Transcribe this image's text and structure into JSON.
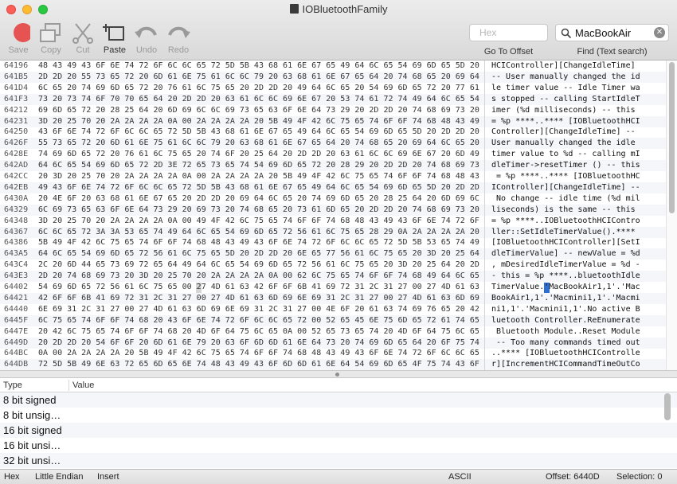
{
  "window": {
    "title": "IOBluetoothFamily"
  },
  "toolbar": {
    "save_label": "Save",
    "copy_label": "Copy",
    "cut_label": "Cut",
    "paste_label": "Paste",
    "undo_label": "Undo",
    "redo_label": "Redo",
    "goto_placeholder": "Hex",
    "goto_label": "Go To Offset",
    "search_value": "MacBookAir",
    "find_label": "Find (Text search)"
  },
  "hex_rows": [
    {
      "offset": "64196",
      "bytes": "48 43 49 43 6F 6E 74 72 6F 6C 6C 65 72 5D 5B 43 68 61 6E 67 65 49 64 6C 65 54 69 6D 65 5D 20",
      "ascii": "HCIController][ChangeIdleTime]"
    },
    {
      "offset": "641B5",
      "bytes": "2D 2D 20 55 73 65 72 20 6D 61 6E 75 61 6C 6C 79 20 63 68 61 6E 67 65 64 20 74 68 65 20 69 64",
      "ascii": "-- User manually changed the id"
    },
    {
      "offset": "641D4",
      "bytes": "6C 65 20 74 69 6D 65 72 20 76 61 6C 75 65 20 2D 2D 20 49 64 6C 65 20 54 69 6D 65 72 20 77 61",
      "ascii": "le timer value -- Idle Timer wa"
    },
    {
      "offset": "641F3",
      "bytes": "73 20 73 74 6F 70 70 65 64 20 2D 2D 20 63 61 6C 6C 69 6E 67 20 53 74 61 72 74 49 64 6C 65 54",
      "ascii": "s stopped -- calling StartIdleT"
    },
    {
      "offset": "64212",
      "bytes": "69 6D 65 72 20 28 25 64 20 6D 69 6C 6C 69 73 65 63 6F 6E 64 73 29 20 2D 2D 20 74 68 69 73 20",
      "ascii": "imer (%d milliseconds) -- this "
    },
    {
      "offset": "64231",
      "bytes": "3D 20 25 70 20 2A 2A 2A 2A 0A 00 2A 2A 2A 2A 20 5B 49 4F 42 6C 75 65 74 6F 6F 74 68 48 43 49",
      "ascii": "= %p ****..**** [IOBluetoothHCI"
    },
    {
      "offset": "64250",
      "bytes": "43 6F 6E 74 72 6F 6C 6C 65 72 5D 5B 43 68 61 6E 67 65 49 64 6C 65 54 69 6D 65 5D 20 2D 2D 20",
      "ascii": "Controller][ChangeIdleTime] -- "
    },
    {
      "offset": "6426F",
      "bytes": "55 73 65 72 20 6D 61 6E 75 61 6C 6C 79 20 63 68 61 6E 67 65 64 20 74 68 65 20 69 64 6C 65 20",
      "ascii": "User manually changed the idle "
    },
    {
      "offset": "6428E",
      "bytes": "74 69 6D 65 72 20 76 61 6C 75 65 20 74 6F 20 25 64 20 2D 2D 20 63 61 6C 6C 69 6E 67 20 6D 49",
      "ascii": "timer value to %d -- calling mI"
    },
    {
      "offset": "642AD",
      "bytes": "64 6C 65 54 69 6D 65 72 2D 3E 72 65 73 65 74 54 69 6D 65 72 20 28 29 20 2D 2D 20 74 68 69 73",
      "ascii": "dleTimer->resetTimer () -- this"
    },
    {
      "offset": "642CC",
      "bytes": "20 3D 20 25 70 20 2A 2A 2A 2A 0A 00 2A 2A 2A 2A 20 5B 49 4F 42 6C 75 65 74 6F 6F 74 68 48 43",
      "ascii": " = %p ****..**** [IOBluetoothHC"
    },
    {
      "offset": "642EB",
      "bytes": "49 43 6F 6E 74 72 6F 6C 6C 65 72 5D 5B 43 68 61 6E 67 65 49 64 6C 65 54 69 6D 65 5D 20 2D 2D",
      "ascii": "IController][ChangeIdleTime] --"
    },
    {
      "offset": "6430A",
      "bytes": "20 4E 6F 20 63 68 61 6E 67 65 20 2D 2D 20 69 64 6C 65 20 74 69 6D 65 20 28 25 64 20 6D 69 6C",
      "ascii": " No change -- idle time (%d mil"
    },
    {
      "offset": "64329",
      "bytes": "6C 69 73 65 63 6F 6E 64 73 29 20 69 73 20 74 68 65 20 73 61 6D 65 20 2D 2D 20 74 68 69 73 20",
      "ascii": "liseconds) is the same -- this "
    },
    {
      "offset": "64348",
      "bytes": "3D 20 25 70 20 2A 2A 2A 2A 0A 00 49 4F 42 6C 75 65 74 6F 6F 74 68 48 43 49 43 6F 6E 74 72 6F",
      "ascii": "= %p ****..IOBluetoothHCIContro"
    },
    {
      "offset": "64367",
      "bytes": "6C 6C 65 72 3A 3A 53 65 74 49 64 6C 65 54 69 6D 65 72 56 61 6C 75 65 28 29 0A 2A 2A 2A 2A 20",
      "ascii": "ller::SetIdleTimerValue().**** "
    },
    {
      "offset": "64386",
      "bytes": "5B 49 4F 42 6C 75 65 74 6F 6F 74 68 48 43 49 43 6F 6E 74 72 6F 6C 6C 65 72 5D 5B 53 65 74 49",
      "ascii": "[IOBluetoothHCIController][SetI"
    },
    {
      "offset": "643A5",
      "bytes": "64 6C 65 54 69 6D 65 72 56 61 6C 75 65 5D 20 2D 2D 20 6E 65 77 56 61 6C 75 65 20 3D 20 25 64",
      "ascii": "dleTimerValue] -- newValue = %d"
    },
    {
      "offset": "643C4",
      "bytes": "2C 20 6D 44 65 73 69 72 65 64 49 64 6C 65 54 69 6D 65 72 56 61 6C 75 65 20 3D 20 25 64 20 2D",
      "ascii": ", mDesiredIdleTimerValue = %d -"
    },
    {
      "offset": "643E3",
      "bytes": "2D 20 74 68 69 73 20 3D 20 25 70 20 2A 2A 2A 2A 0A 00 62 6C 75 65 74 6F 6F 74 68 49 64 6C 65",
      "ascii": "- this = %p ****..bluetoothIdle"
    },
    {
      "offset": "64402",
      "bytes": "54 69 6D 65 72 56 61 6C 75 65 00 27 4D 61 63 42 6F 6F 6B 41 69 72 31 2C 31 27 00 27 4D 61 63",
      "ascii": "TimerValue.'MacBookAir1,1'.'Mac"
    },
    {
      "offset": "64421",
      "bytes": "42 6F 6F 6B 41 69 72 31 2C 31 27 00 27 4D 61 63 6D 69 6E 69 31 2C 31 27 00 27 4D 61 63 6D 69",
      "ascii": "BookAir1,1'.'Macmini1,1'.'Macmi"
    },
    {
      "offset": "64440",
      "bytes": "6E 69 31 2C 31 27 00 27 4D 61 63 6D 69 6E 69 31 2C 31 27 00 4E 6F 20 61 63 74 69 76 65 20 42",
      "ascii": "ni1,1'.'Macmini1,1'.No active B"
    },
    {
      "offset": "6445F",
      "bytes": "6C 75 65 74 6F 6F 74 68 20 43 6F 6E 74 72 6F 6C 6C 65 72 00 52 65 45 6E 75 6D 65 72 61 74 65",
      "ascii": "luetooth Controller.ReEnumerate"
    },
    {
      "offset": "6447E",
      "bytes": "20 42 6C 75 65 74 6F 6F 74 68 20 4D 6F 64 75 6C 65 0A 00 52 65 73 65 74 20 4D 6F 64 75 6C 65",
      "ascii": " Bluetooth Module..Reset Module"
    },
    {
      "offset": "6449D",
      "bytes": "20 2D 2D 20 54 6F 6F 20 6D 61 6E 79 20 63 6F 6D 6D 61 6E 64 73 20 74 69 6D 65 64 20 6F 75 74",
      "ascii": " -- Too many commands timed out"
    },
    {
      "offset": "644BC",
      "bytes": "0A 00 2A 2A 2A 2A 20 5B 49 4F 42 6C 75 65 74 6F 6F 74 68 48 43 49 43 6F 6E 74 72 6F 6C 6C 65",
      "ascii": "..**** [IOBluetoothHCIControlle"
    },
    {
      "offset": "644DB",
      "bytes": "72 5D 5B 49 6E 63 72 65 6D 65 6E 74 48 43 49 43 6F 6D 6D 61 6E 64 54 69 6D 65 4F 75 74 43 6F",
      "ascii": "r][IncrementHCICommandTimeOutCo"
    }
  ],
  "inspector": {
    "col_type": "Type",
    "col_value": "Value",
    "rows": [
      "8 bit signed",
      "8 bit unsig…",
      "16 bit signed",
      "16 bit unsi…",
      "32 bit unsi…"
    ]
  },
  "status": {
    "line_ending": "Hex",
    "endian": "Little Endian",
    "mode": "Insert",
    "encoding": "ASCII",
    "offset": "Offset: 6440D",
    "selection": "Selection: 0"
  }
}
